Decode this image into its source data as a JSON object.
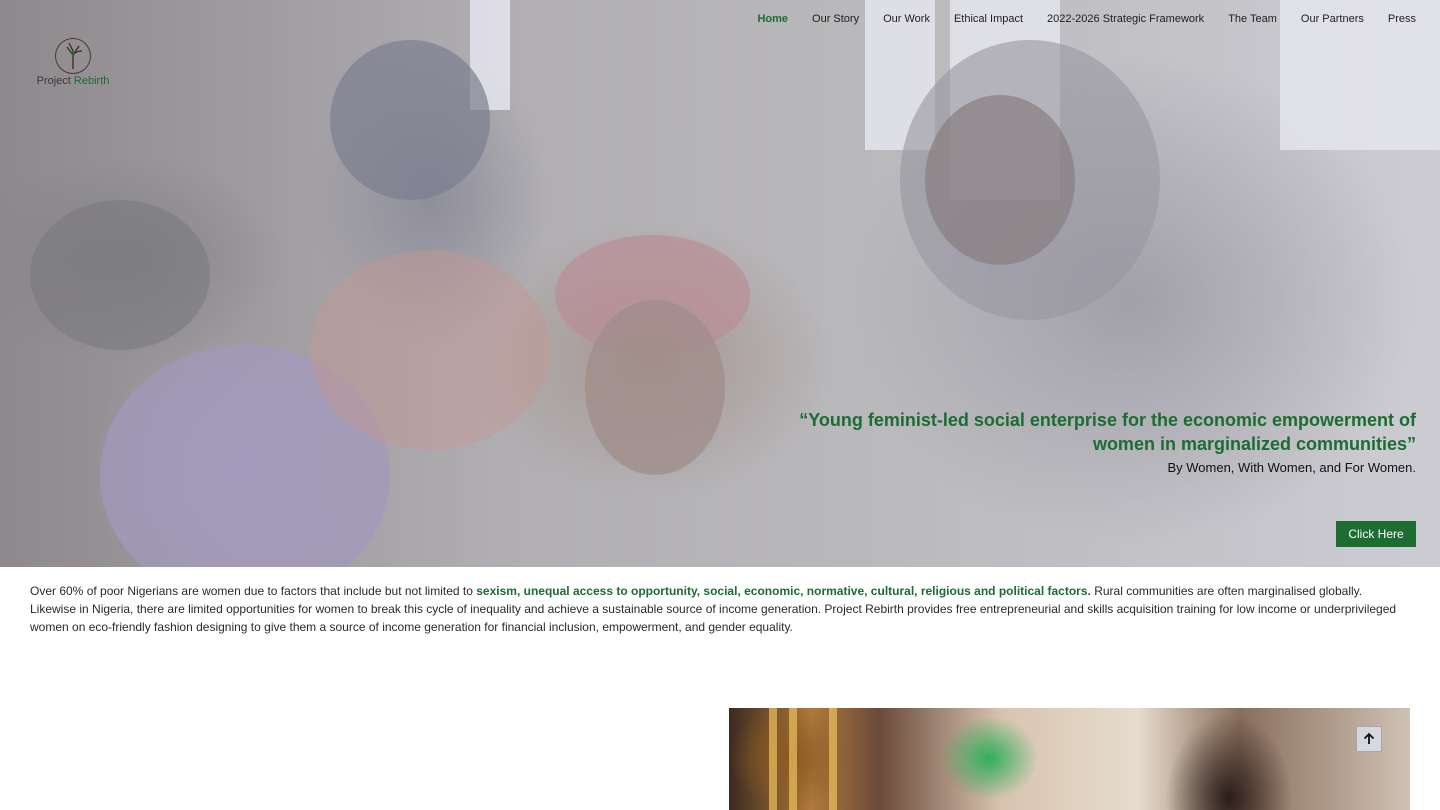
{
  "logo": {
    "text_main": "Project",
    "text_accent": "Rebirth",
    "icon": "tree-woman-icon"
  },
  "nav": [
    {
      "label": "Home",
      "active": true
    },
    {
      "label": "Our Story"
    },
    {
      "label": "Our Work"
    },
    {
      "label": "Ethical Impact"
    },
    {
      "label": "2022-2026 Strategic Framework"
    },
    {
      "label": "The Team"
    },
    {
      "label": "Our Partners"
    },
    {
      "label": "Press"
    }
  ],
  "hero": {
    "quote": "“Young feminist-led social enterprise for the economic empowerment of women in marginalized communities”",
    "subtitle": "By Women, With Women, and For Women.",
    "cta_label": "Click Here"
  },
  "intro": {
    "before": "Over 60% of poor Nigerians are women due to factors that include but not limited to ",
    "highlight": "sexism, unequal access to opportunity, social, economic, normative, cultural, religious and political factors.",
    "after": " Rural communities are often marginalised globally. Likewise in Nigeria, there are limited opportunities for women to break this cycle of inequality and achieve a sustainable source of income generation. Project Rebirth provides free entrepreneurial and skills acquisition training for low income or underprivileged women on eco-friendly fashion designing to give them a source of income generation for financial inclusion, empowerment, and gender equality."
  },
  "scroll_top": {
    "icon": "arrow-up-icon"
  },
  "colors": {
    "brand_green": "#1b6d31"
  }
}
